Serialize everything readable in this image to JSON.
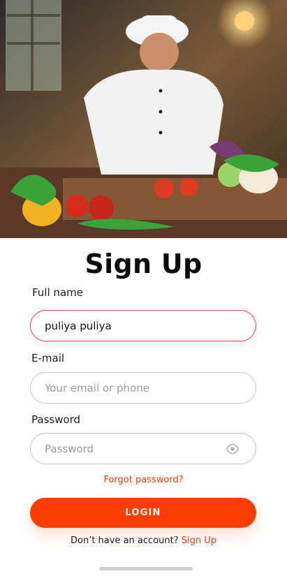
{
  "hero": {
    "image_desc": "chef-photo",
    "colors": {
      "wood": "#6f4b33",
      "wall_warm": "#d69a5b",
      "tomato": "#d72b1d",
      "pepper_yellow": "#f2b120",
      "green": "#3aa43a",
      "chef_white": "#f3f3f3"
    }
  },
  "header": {
    "title": "Sign Up"
  },
  "form": {
    "full_name": {
      "label": "Full name",
      "value": "puliya puliya",
      "placeholder": ""
    },
    "email": {
      "label": "E-mail",
      "value": "",
      "placeholder": "Your email or phone"
    },
    "password": {
      "label": "Password",
      "value": "",
      "placeholder": "Password",
      "toggle_icon": "eye-icon"
    },
    "forgot_password_label": "Forgot password?",
    "login_label": "LOGIN"
  },
  "footer": {
    "prompt": "Don’t have an account?",
    "signup_label": "Sign Up"
  },
  "theme": {
    "accent": "#ff3d00",
    "focus_border": "#e04a55",
    "border": "#c8c8c8"
  }
}
